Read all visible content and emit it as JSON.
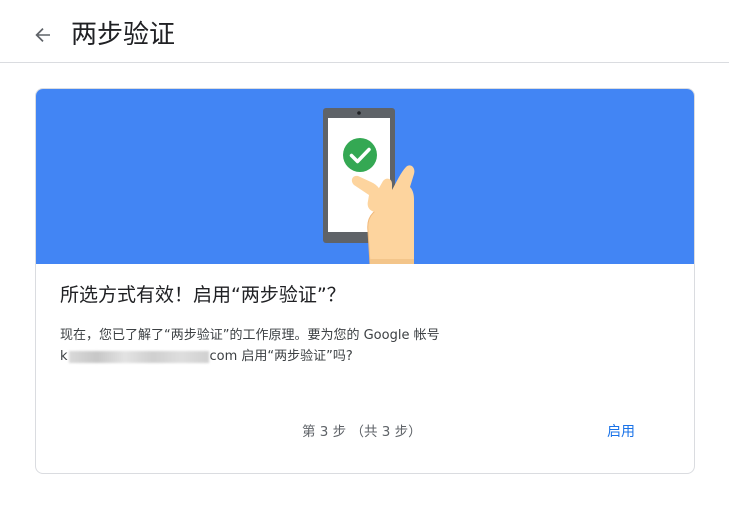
{
  "header": {
    "title": "两步验证",
    "back_icon": "arrow-back-icon"
  },
  "card": {
    "banner_color": "#4285f4",
    "illustration": "phone-checkmark-icon",
    "title": "所选方式有效！启用“两步验证”？",
    "body_prefix": "现在，您已了解了“两步验证”的工作原理。要为您的 Google 帐号",
    "email_start": "k",
    "email_end": "com",
    "body_suffix": " 启用“两步验证”吗?",
    "step_text": "第 3 步 （共 3 步）",
    "enable_label": "启用"
  },
  "colors": {
    "accent": "#1a73e8",
    "check": "#34a853"
  }
}
